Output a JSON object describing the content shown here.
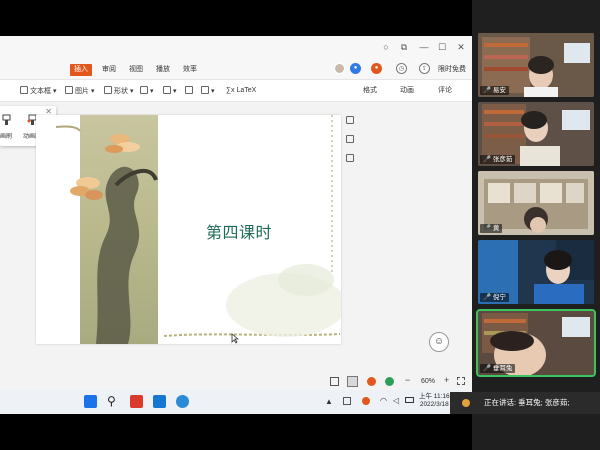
{
  "window": {
    "controls": [
      "○",
      "⧉",
      "—",
      "☐",
      "✕"
    ]
  },
  "menu": {
    "items": [
      "插入",
      "审阅",
      "视图",
      "播放",
      "效率"
    ],
    "active_index": 0,
    "login_label": "限时免费"
  },
  "toolbar": {
    "textbox": "文本框",
    "picture": "图片",
    "shape": "形状",
    "latex": "LaTeX"
  },
  "panel_tabs": [
    "格式",
    "动画",
    "评论"
  ],
  "popup": {
    "labels": [
      "画刷",
      "动画刷"
    ],
    "close": "✕"
  },
  "slide": {
    "title": "第四课时"
  },
  "status": {
    "zoom": "60%",
    "minus": "−",
    "plus": "+"
  },
  "taskbar": {
    "time": "上午 11:16",
    "date": "2022/3/18"
  },
  "meeting": {
    "participants": [
      {
        "name": "易安",
        "active": false
      },
      {
        "name": "张彦茹",
        "active": false
      },
      {
        "name": "黄",
        "active": false
      },
      {
        "name": "倪宁",
        "active": false
      },
      {
        "name": "垂耳兔",
        "active": true
      }
    ],
    "speaking_label": "正在讲话: 垂耳兔; 张彦茹;"
  },
  "colors": {
    "accent": "#e2571c",
    "slide_title": "#1f6b5a",
    "active_speaker": "#3cc45f"
  }
}
